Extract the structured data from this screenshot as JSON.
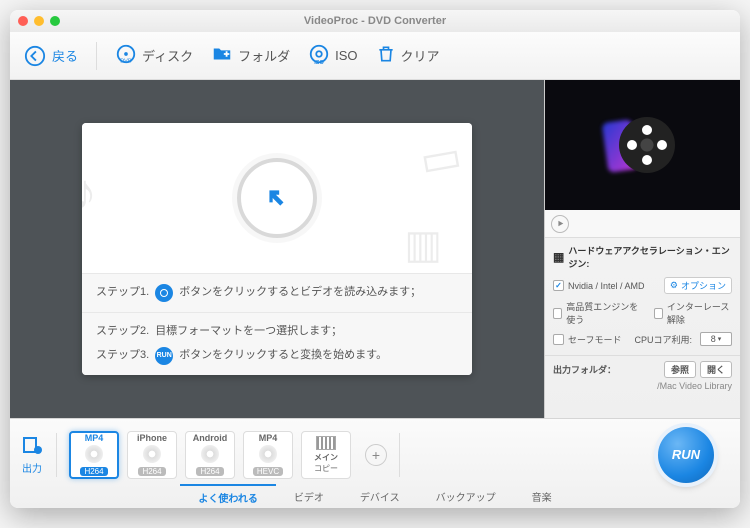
{
  "title": "VideoProc - DVD Converter",
  "toolbar": {
    "back": "戻る",
    "disc": "ディスク",
    "folder": "フォルダ",
    "iso": "ISO",
    "clear": "クリア"
  },
  "steps": {
    "s1_label": "ステップ1.",
    "s1_text": "ボタンをクリックするとビデオを読み込みます；",
    "s2_label": "ステップ2.",
    "s2_text": "目標フォーマットを一つ選択します；",
    "s3_label": "ステップ3.",
    "s3_text": "ボタンをクリックすると変換を始めます。",
    "run_icon_text": "RUN"
  },
  "side": {
    "hw_title": "ハードウェアアクセラレーション・エンジン:",
    "nvidia": "Nvidia / Intel / AMD",
    "option": "オプション",
    "hq": "高品質エンジンを使う",
    "deint": "インターレース解除",
    "safe": "セーフモード",
    "cpu_label": "CPUコア利用:",
    "cpu_value": "8",
    "out_label": "出力フォルダ：",
    "browse": "参照",
    "open": "開く",
    "out_path": "/Mac Video Library"
  },
  "presets": {
    "out": "出力",
    "items": [
      {
        "fmt": "MP4",
        "sub": "H264",
        "selected": true
      },
      {
        "fmt": "iPhone",
        "sub": "H264",
        "selected": false
      },
      {
        "fmt": "Android",
        "sub": "H264",
        "selected": false
      },
      {
        "fmt": "MP4",
        "sub": "HEVC",
        "selected": false
      }
    ],
    "maincopy_l1": "メイン",
    "maincopy_l2": "コピー",
    "run": "RUN"
  },
  "tabs": [
    "よく使われる",
    "ビデオ",
    "デバイス",
    "バックアップ",
    "音楽"
  ],
  "active_tab": 0
}
